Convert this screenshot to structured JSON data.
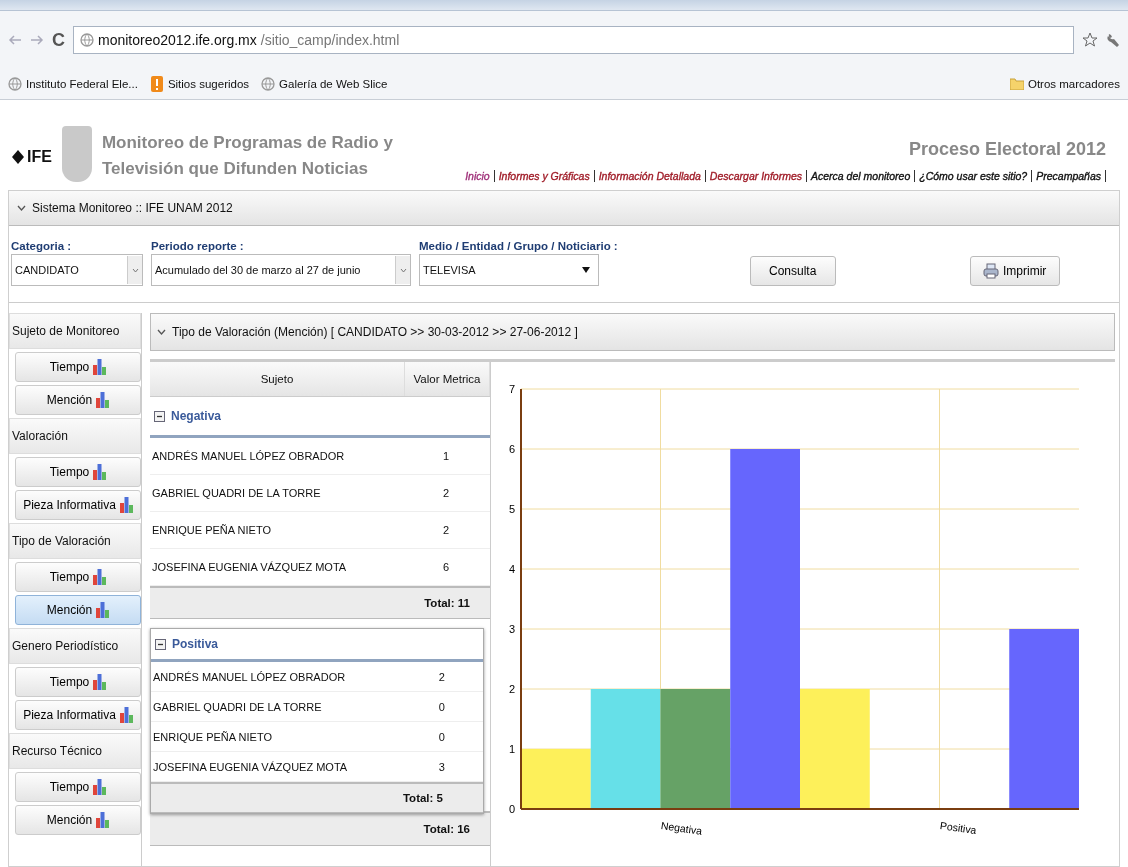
{
  "browser": {
    "url_host": "monitoreo2012.ife.org.mx",
    "url_path": "/sitio_camp/index.html",
    "reload": "C",
    "bookmarks": [
      {
        "label": "Instituto Federal Ele...",
        "kind": "globe"
      },
      {
        "label": "Sitios sugeridos",
        "kind": "flag"
      },
      {
        "label": "Galería de Web Slice",
        "kind": "globe"
      }
    ],
    "other_bookmarks": "Otros marcadores"
  },
  "header": {
    "logo_text": "IFE",
    "title_lines": [
      "Monitoreo de Programas de Radio y",
      "Televisión que Difunden Noticias"
    ],
    "subtitle": "Proceso Electoral 2012",
    "nav": [
      {
        "label": "Inicio",
        "color": "#a0307a"
      },
      {
        "label": "Informes y Gráficas",
        "color": "#a01c28"
      },
      {
        "label": "Información Detallada",
        "color": "#a01c28"
      },
      {
        "label": "Descargar Informes",
        "color": "#a01c28"
      },
      {
        "label": "Acerca del monitoreo",
        "color": "#111111"
      },
      {
        "label": "¿Cómo usar este sitio?",
        "color": "#111111"
      },
      {
        "label": "Precampañas",
        "color": "#111111"
      }
    ]
  },
  "panel": {
    "title": "Sistema Monitoreo :: IFE UNAM 2012",
    "filters": [
      {
        "label": "Categoria :",
        "value": "CANDIDATO",
        "kind": "combo"
      },
      {
        "label": "Periodo reporte :",
        "value": "Acumulado del 30 de marzo al 27 de junio",
        "kind": "combo"
      },
      {
        "label": "Medio / Entidad / Grupo / Noticiario :",
        "value": "TELEVISA",
        "kind": "select"
      }
    ],
    "buttons": [
      {
        "label": "Consulta",
        "kind": "plain"
      },
      {
        "label": "Imprimir",
        "kind": "print"
      }
    ]
  },
  "sidebar": {
    "items": [
      {
        "label": "Sujeto de Monitoreo",
        "kind": "section"
      },
      {
        "label": "Tiempo",
        "kind": "button",
        "selected": false
      },
      {
        "label": "Mención",
        "kind": "button",
        "selected": false
      },
      {
        "label": "Valoración",
        "kind": "section"
      },
      {
        "label": "Tiempo",
        "kind": "button",
        "selected": false
      },
      {
        "label": "Pieza Informativa",
        "kind": "button",
        "selected": false
      },
      {
        "label": "Tipo de Valoración",
        "kind": "section"
      },
      {
        "label": "Tiempo",
        "kind": "button",
        "selected": false
      },
      {
        "label": "Mención",
        "kind": "button",
        "selected": true
      },
      {
        "label": "Genero Periodístico",
        "kind": "section"
      },
      {
        "label": "Tiempo",
        "kind": "button",
        "selected": false
      },
      {
        "label": "Pieza Informativa",
        "kind": "button",
        "selected": false
      },
      {
        "label": "Recurso Técnico",
        "kind": "section"
      },
      {
        "label": "Tiempo",
        "kind": "button",
        "selected": false
      },
      {
        "label": "Mención",
        "kind": "button",
        "selected": false
      }
    ]
  },
  "report": {
    "title": "Tipo de Valoración (Mención) [ CANDIDATO >> 30-03-2012 >> 27-06-2012 ]",
    "columns": [
      "Sujeto",
      "Valor Metrica"
    ],
    "group": {
      "name": "Negativa",
      "rows": [
        [
          "ANDRÉS MANUEL LÓPEZ OBRADOR",
          "1"
        ],
        [
          "GABRIEL QUADRI DE LA TORRE",
          "2"
        ],
        [
          "ENRIQUE PEÑA NIETO",
          "2"
        ],
        [
          "JOSEFINA EUGENIA VÁZQUEZ MOTA",
          "6"
        ]
      ],
      "total": "Total: 11"
    },
    "grand_total": "Total: 16",
    "popup": {
      "name": "Positiva",
      "rows": [
        [
          "ANDRÉS MANUEL LÓPEZ OBRADOR",
          "2"
        ],
        [
          "GABRIEL QUADRI DE LA TORRE",
          "0"
        ],
        [
          "ENRIQUE PEÑA NIETO",
          "0"
        ],
        [
          "JOSEFINA EUGENIA VÁZQUEZ MOTA",
          "3"
        ]
      ],
      "total": "Total: 5"
    },
    "chart_data": {
      "type": "bar",
      "categories": [
        "Negativa",
        "Positiva"
      ],
      "series": [
        {
          "color": "#fdf05a",
          "values": [
            1,
            2
          ]
        },
        {
          "color": "#66e0e8",
          "values": [
            2,
            0
          ]
        },
        {
          "color": "#66a266",
          "values": [
            2,
            0
          ]
        },
        {
          "color": "#6666fd",
          "values": [
            6,
            3
          ]
        }
      ],
      "ylim": [
        0,
        7
      ],
      "yticks": [
        0,
        1,
        2,
        3,
        4,
        5,
        6,
        7
      ],
      "grid": true
    }
  }
}
